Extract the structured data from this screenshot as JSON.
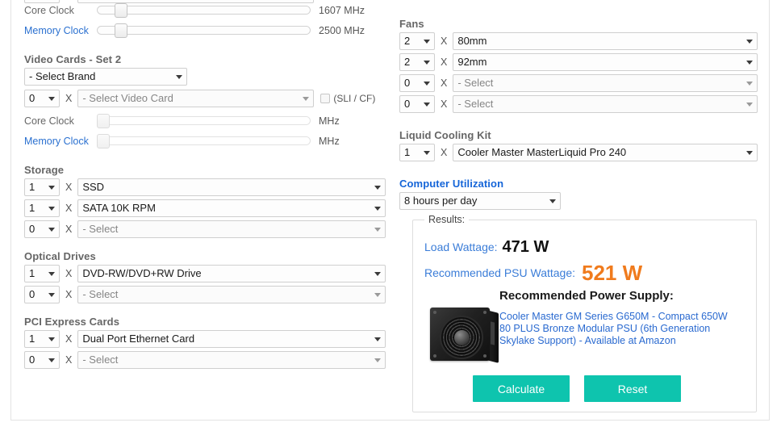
{
  "video_cards_set1": {
    "core_clock": {
      "label": "Core Clock",
      "value": "1607 MHz",
      "handle_pct": 8
    },
    "memory_clock": {
      "label": "Memory Clock",
      "value": "2500 MHz",
      "handle_pct": 8
    }
  },
  "video_cards_set2": {
    "heading": "Video Cards - Set 2",
    "brand_select": "- Select Brand",
    "qty": "0",
    "x": "X",
    "card_select": "- Select Video Card",
    "sli_label": "(SLI / CF)",
    "core_clock": {
      "label": "Core Clock",
      "value": "MHz",
      "handle_pct": 0
    },
    "memory_clock": {
      "label": "Memory Clock",
      "value": "MHz",
      "handle_pct": 0
    }
  },
  "storage": {
    "heading": "Storage",
    "rows": [
      {
        "qty": "1",
        "x": "X",
        "item": "SSD",
        "muted": false
      },
      {
        "qty": "1",
        "x": "X",
        "item": "SATA 10K RPM",
        "muted": false
      },
      {
        "qty": "0",
        "x": "X",
        "item": "- Select",
        "muted": true
      }
    ]
  },
  "optical_drives": {
    "heading": "Optical Drives",
    "rows": [
      {
        "qty": "1",
        "x": "X",
        "item": "DVD-RW/DVD+RW Drive",
        "muted": false
      },
      {
        "qty": "0",
        "x": "X",
        "item": "- Select",
        "muted": true
      }
    ]
  },
  "pci_express_cards": {
    "heading": "PCI Express Cards",
    "rows": [
      {
        "qty": "1",
        "x": "X",
        "item": "Dual Port Ethernet Card",
        "muted": false
      },
      {
        "qty": "0",
        "x": "X",
        "item": "- Select",
        "muted": true
      }
    ]
  },
  "fans": {
    "heading": "Fans",
    "rows": [
      {
        "qty": "2",
        "x": "X",
        "item": "80mm",
        "muted": false
      },
      {
        "qty": "2",
        "x": "X",
        "item": "92mm",
        "muted": false
      },
      {
        "qty": "0",
        "x": "X",
        "item": "- Select",
        "muted": true
      },
      {
        "qty": "0",
        "x": "X",
        "item": "- Select",
        "muted": true
      }
    ]
  },
  "liquid_cooling_kit": {
    "heading": "Liquid Cooling Kit",
    "rows": [
      {
        "qty": "1",
        "x": "X",
        "item": "Cooler Master MasterLiquid Pro 240",
        "muted": false
      }
    ]
  },
  "computer_utilization": {
    "heading": "Computer Utilization",
    "selected": "8 hours per day"
  },
  "results": {
    "legend": "Results:",
    "load_wattage_label": "Load Wattage:",
    "load_wattage_value": "471 W",
    "recommended_psu_label": "Recommended PSU Wattage:",
    "recommended_psu_value": "521 W",
    "recommended_title": "Recommended Power Supply:",
    "product_link": "Cooler Master GM Series G650M - Compact 650W 80 PLUS Bronze Modular PSU (6th Generation Skylake Support) - Available at Amazon",
    "calculate_label": "Calculate",
    "reset_label": "Reset",
    "accent_color": "#0ec4ae",
    "orange_color": "#f07b1d",
    "link_color": "#2a6ad0"
  }
}
